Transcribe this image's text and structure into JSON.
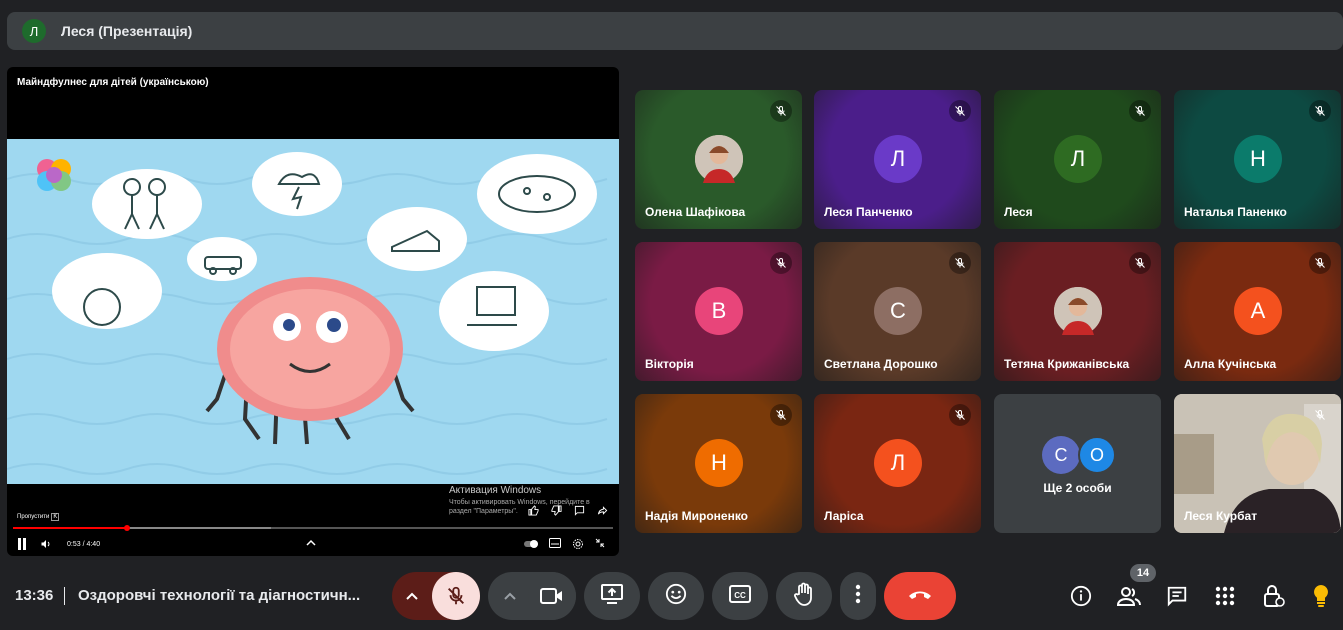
{
  "presenter": {
    "initial": "Л",
    "name": "Леся (Презентація)"
  },
  "presentation": {
    "video_title": "Майндфулнес для дітей (українською)",
    "watermark_line1": "Активация Windows",
    "watermark_line2": "Чтобы активировать Windows, перейдите в раздел \"Параметры\".",
    "skip_label": "Пропустити",
    "skip_key": "K",
    "time": "0:53 / 4:40",
    "progress": 0.19,
    "buffered": 0.43
  },
  "participants": [
    {
      "name": "Олена Шафікова",
      "initial": "",
      "photo": true,
      "bg": "#2a5a2a",
      "avatar_color": ""
    },
    {
      "name": "Леся Панченко",
      "initial": "Л",
      "photo": false,
      "bg": "#4b1e8a",
      "avatar_color": "#6a3ac8"
    },
    {
      "name": "Леся",
      "initial": "Л",
      "photo": false,
      "bg": "#1f4a1c",
      "avatar_color": "#2e6b22"
    },
    {
      "name": "Наталья Паненко",
      "initial": "Н",
      "photo": false,
      "bg": "#0d4a42",
      "avatar_color": "#0b7b6b"
    },
    {
      "name": "Вікторія",
      "initial": "В",
      "photo": false,
      "bg": "#7a1b45",
      "avatar_color": "#e8457a"
    },
    {
      "name": "Светлана Дорошко",
      "initial": "С",
      "photo": false,
      "bg": "#5a3a28",
      "avatar_color": "#8d6e63"
    },
    {
      "name": "Тетяна Крижанівська",
      "initial": "",
      "photo": true,
      "bg": "#6a1e22",
      "avatar_color": ""
    },
    {
      "name": "Алла Кучінська",
      "initial": "А",
      "photo": false,
      "bg": "#7a2a10",
      "avatar_color": "#f4511e"
    },
    {
      "name": "Надія Мироненко",
      "initial": "Н",
      "photo": false,
      "bg": "#7a3a0a",
      "avatar_color": "#ef6c00"
    },
    {
      "name": "Ларіса",
      "initial": "Л",
      "photo": false,
      "bg": "#7a2612",
      "avatar_color": "#f4511e"
    }
  ],
  "more_tile": {
    "label": "Ще 2 особи",
    "initials": [
      "С",
      "О"
    ],
    "colors": [
      "#5c6bc0",
      "#1e88e5"
    ]
  },
  "self_tile": {
    "name": "Леся Курбат"
  },
  "bottom_bar": {
    "time": "13:36",
    "meeting_name": "Оздоровчі технології та діагностичн...",
    "people_count": "14"
  },
  "icons": {
    "mic": "mic-off-icon",
    "camera": "camera-icon",
    "present": "present-screen-icon",
    "reactions": "emoji-icon",
    "captions": "captions-icon",
    "hand": "raise-hand-icon",
    "more": "more-vert-icon",
    "leave": "call-end-icon",
    "info": "info-icon",
    "people": "people-icon",
    "chat": "chat-icon",
    "activities": "apps-grid-icon",
    "host": "host-controls-icon",
    "ai": "lightbulb-icon"
  },
  "colors": {
    "leave": "#ea4335",
    "mic_active_bg": "#f9dedc",
    "mic_group_bg": "#5c1d18",
    "ai_yellow": "#fbbc04"
  }
}
